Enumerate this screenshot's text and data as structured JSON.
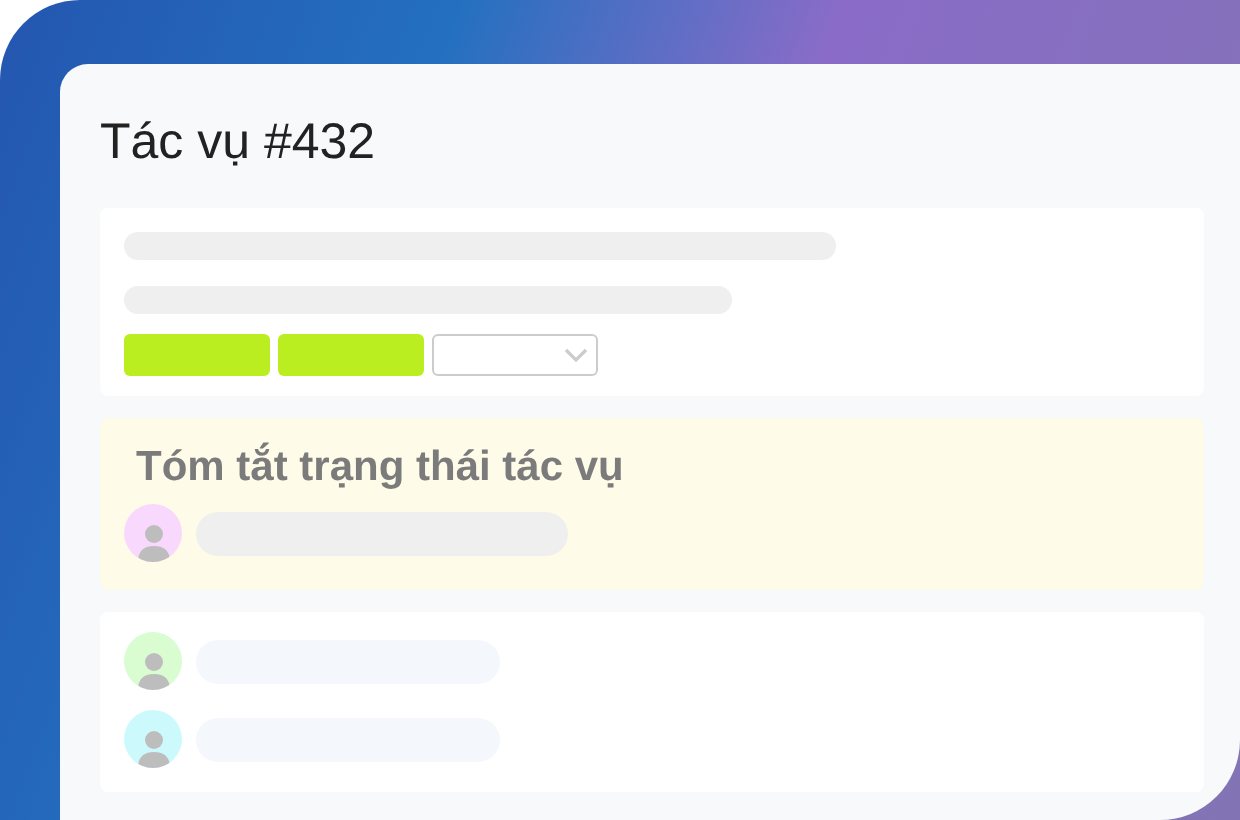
{
  "title": "Tác vụ #432",
  "summary": {
    "heading": "Tóm tắt trạng thái tác vụ",
    "people": [
      {
        "color": "#f8d8fc"
      }
    ]
  },
  "comments": [
    {
      "color": "#d9fcd0"
    },
    {
      "color": "#ccfafc"
    }
  ]
}
